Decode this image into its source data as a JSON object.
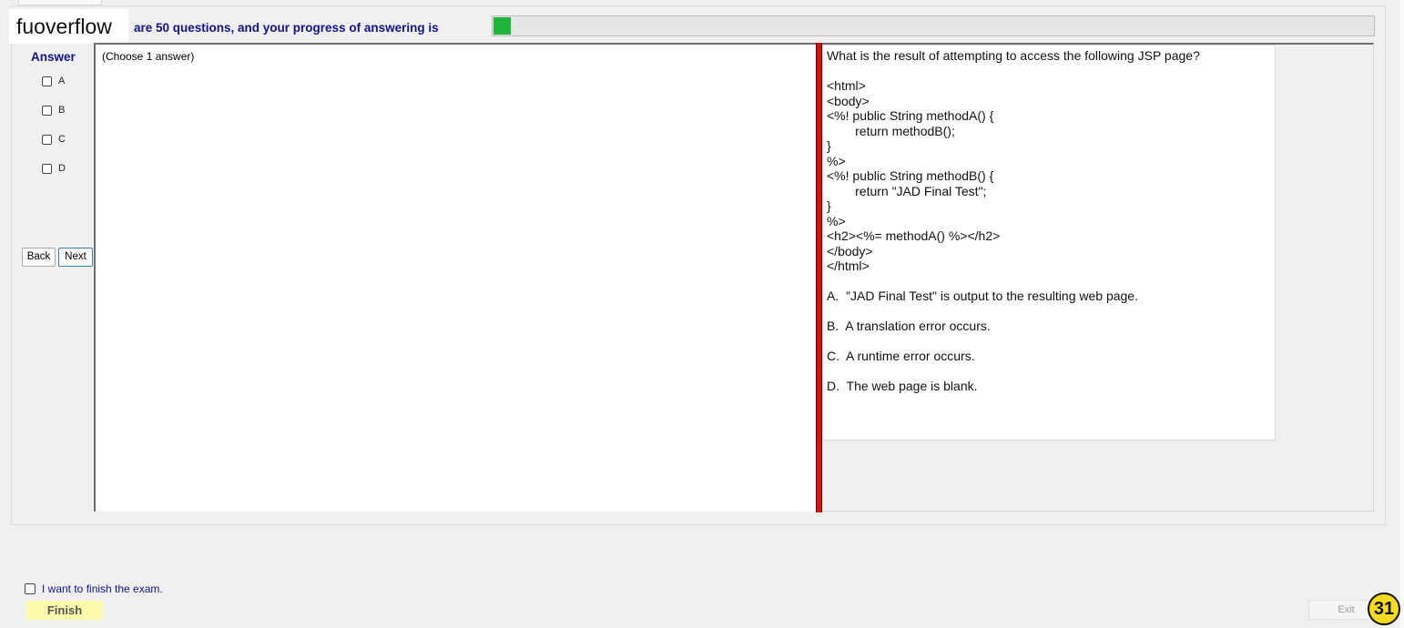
{
  "brand": "fuoverflow",
  "progress": {
    "text": "are 50 questions, and your progress of answering is",
    "fraction": 0.02,
    "fill_color": "#1fb53a"
  },
  "answer_panel": {
    "title": "Answer",
    "options": [
      "A",
      "B",
      "C",
      "D"
    ],
    "back_label": "Back",
    "next_label": "Next",
    "hint": "(Choose 1 answer)"
  },
  "question": {
    "lines": [
      "What is the result of attempting to access the following JSP page?",
      "",
      "<html>",
      "<body>",
      "<%! public String methodA() {",
      "        return methodB();",
      "}",
      "%>",
      "<%! public String methodB() {",
      "        return \"JAD Final Test\";",
      "}",
      "%>",
      "<h2><%= methodA() %></h2>",
      "</body>",
      "</html>",
      "",
      "A.  \"JAD Final Test\" is output to the resulting web page.",
      "",
      "B.  A translation error occurs.",
      "",
      "C.  A runtime error occurs.",
      "",
      "D.  The web page is blank."
    ]
  },
  "footer": {
    "finish_checkbox_label": "I want to finish the exam.",
    "finish_label": "Finish",
    "exit_label": "Exit",
    "page_number": "31"
  },
  "colors": {
    "splitter": "#d11414",
    "heading_text": "#12128a",
    "finish_button": "#fbfbab",
    "badge": "#f7dc1d"
  }
}
